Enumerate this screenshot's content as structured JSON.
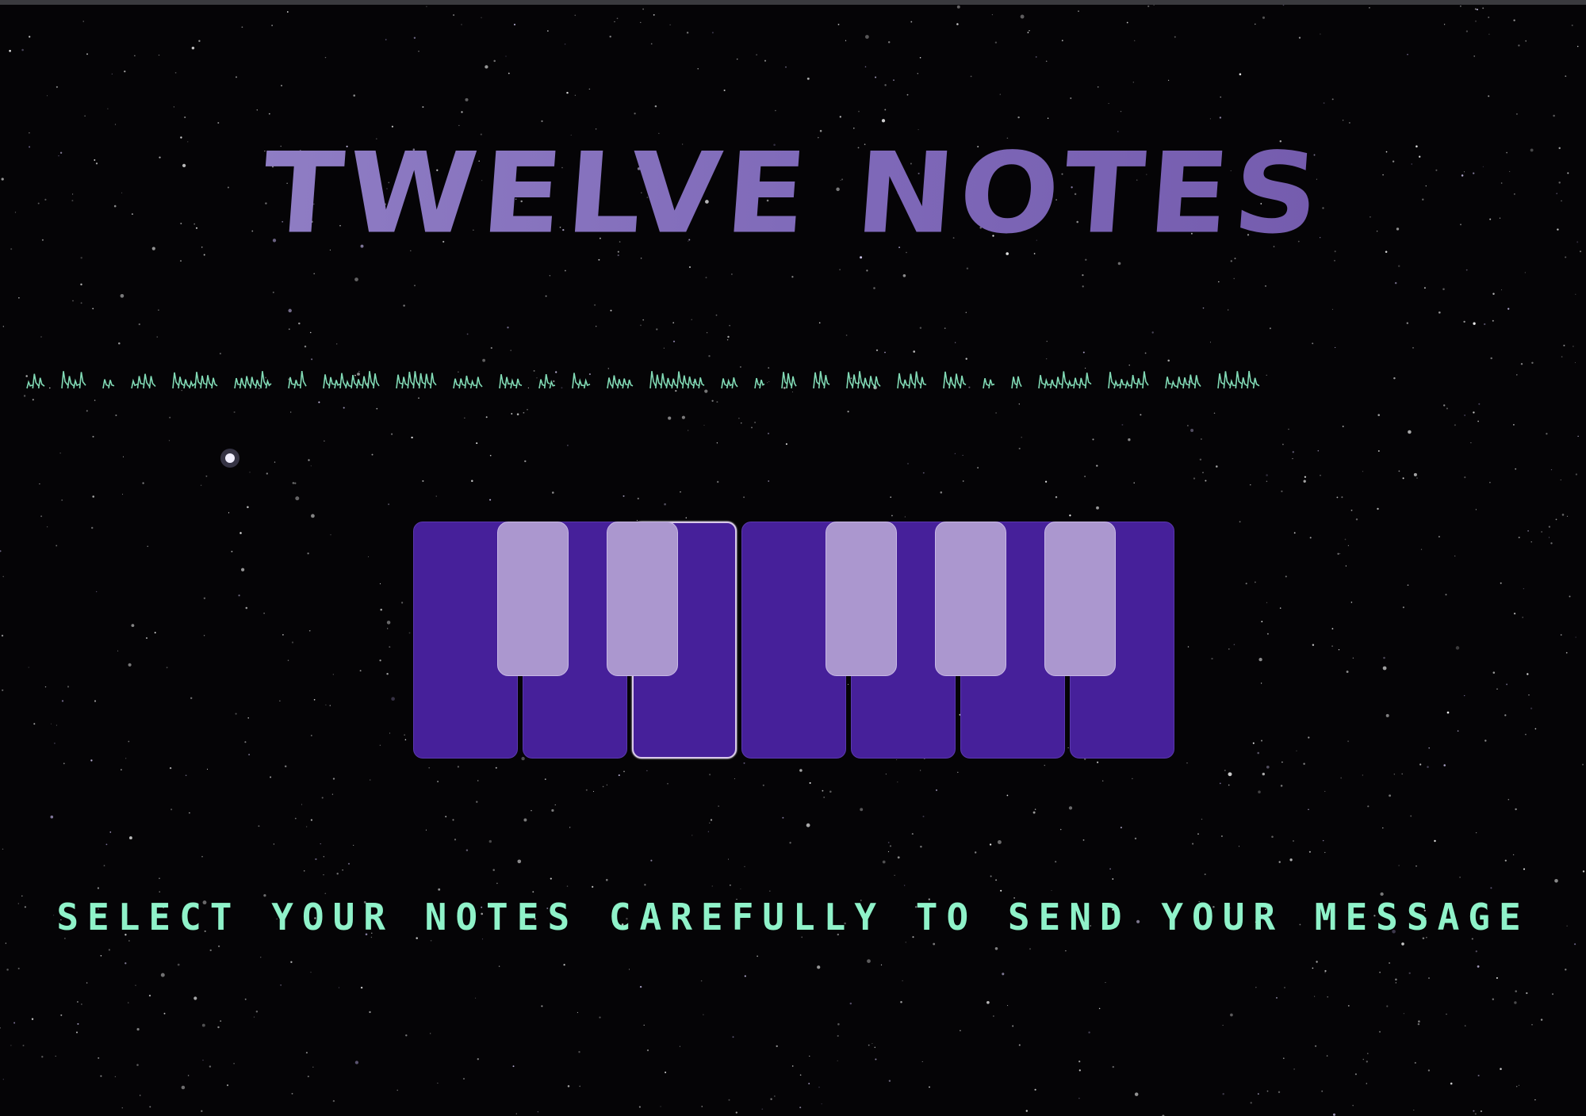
{
  "app": {
    "title": "TWELVE NOTES",
    "instruction": "SELECT YOUR NOTES CAREFULLY TO SEND YOUR MESSAGE"
  },
  "colors": {
    "background": "#050406",
    "title_gradient_start": "#9686c9",
    "title_gradient_end": "#6f55a8",
    "alien_text": "#8ff2c9",
    "instruction_text": "#8ff2c9",
    "white_key": "#46209a",
    "black_key": "#ab97cf",
    "active_key_border": "#d9c9ea"
  },
  "keyboard": {
    "white_keys": [
      {
        "name": "white-key-1",
        "active": false
      },
      {
        "name": "white-key-2",
        "active": false
      },
      {
        "name": "white-key-3",
        "active": true
      },
      {
        "name": "white-key-4",
        "active": false
      },
      {
        "name": "white-key-5",
        "active": false
      },
      {
        "name": "white-key-6",
        "active": false
      },
      {
        "name": "white-key-7",
        "active": false
      }
    ],
    "black_keys": [
      {
        "name": "black-key-1"
      },
      {
        "name": "black-key-2"
      },
      {
        "name": "black-key-3"
      },
      {
        "name": "black-key-4"
      },
      {
        "name": "black-key-5"
      }
    ]
  }
}
